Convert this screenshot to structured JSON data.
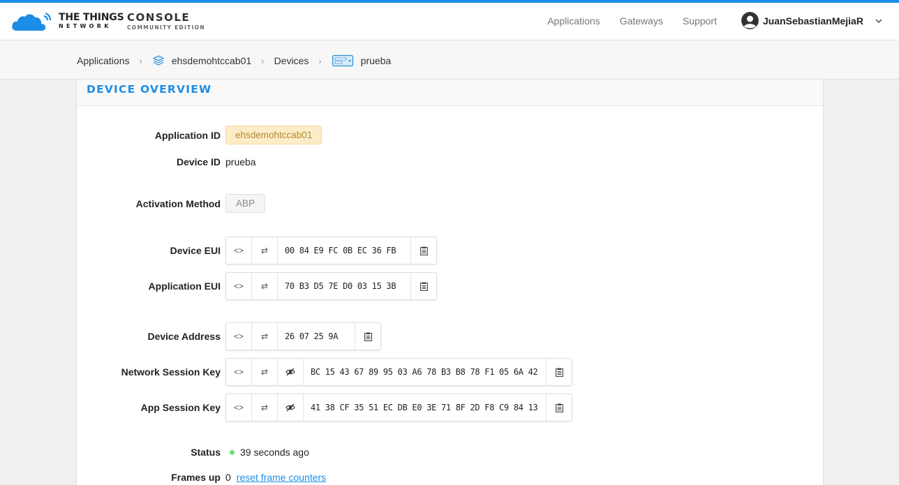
{
  "brand": {
    "name_main": "THE THINGS",
    "name_sub": "NETWORK",
    "console_main": "CONSOLE",
    "console_sub": "COMMUNITY EDITION",
    "accent_color": "#1d8ee6"
  },
  "nav": {
    "items": [
      "Applications",
      "Gateways",
      "Support"
    ]
  },
  "user": {
    "name": "JuanSebastianMejiaR"
  },
  "breadcrumb": {
    "items": [
      "Applications",
      "ehsdemohtccab01",
      "Devices",
      "prueba"
    ]
  },
  "card": {
    "title": "DEVICE OVERVIEW"
  },
  "device": {
    "app_id_label": "Application ID",
    "app_id": "ehsdemohtccab01",
    "device_id_label": "Device ID",
    "device_id": "prueba",
    "activation_label": "Activation Method",
    "activation": "ABP",
    "device_eui_label": "Device EUI",
    "device_eui": "00 84 E9 FC 0B EC 36 FB",
    "app_eui_label": "Application EUI",
    "app_eui": "70 B3 D5 7E D0 03 15 3B",
    "dev_addr_label": "Device Address",
    "dev_addr": "26 07 25 9A",
    "nwk_skey_label": "Network Session Key",
    "nwk_skey": "BC 15 43 67 89 95 03 A6 78 B3 B8 78 F1 05 6A 42",
    "app_skey_label": "App Session Key",
    "app_skey": "41 38 CF 35 51 EC DB E0 3E 71 8F 2D F8 C9 84 13",
    "status_label": "Status",
    "status": "39 seconds ago",
    "frames_up_label": "Frames up",
    "frames_up": "0",
    "reset_link": "reset frame counters"
  },
  "icons": {
    "format": "<>",
    "swap": "⇄"
  }
}
